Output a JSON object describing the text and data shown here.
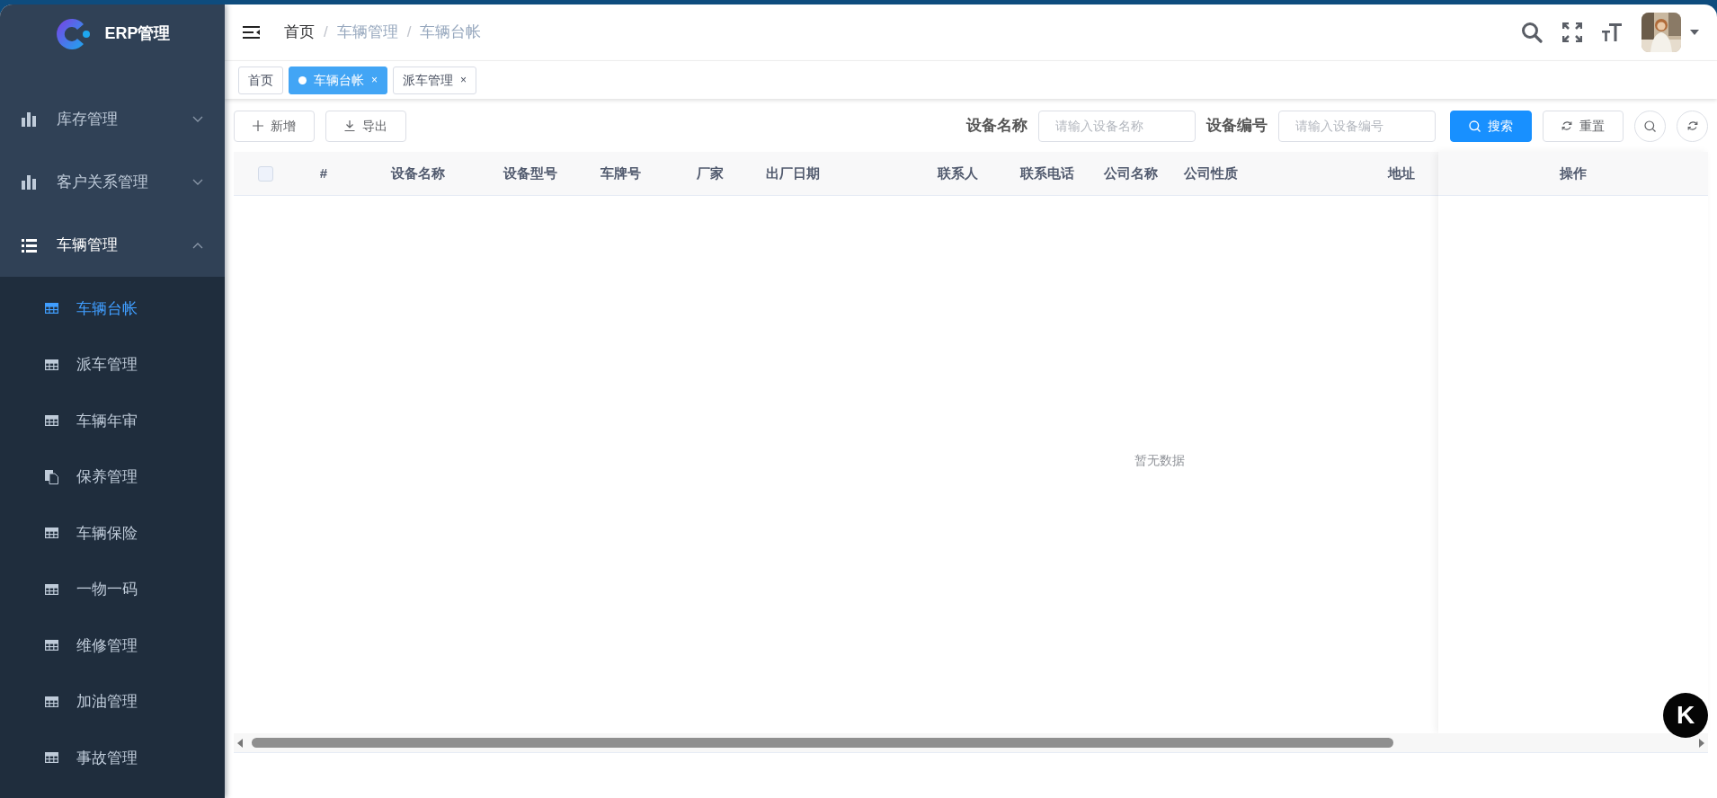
{
  "logo": {
    "title": "ERP管理"
  },
  "sidebar": {
    "items": [
      {
        "label": "库存管理",
        "expanded": false
      },
      {
        "label": "客户关系管理",
        "expanded": false
      },
      {
        "label": "车辆管理",
        "expanded": true,
        "children": [
          {
            "label": "车辆台帐",
            "kind": "grid",
            "selected": true
          },
          {
            "label": "派车管理",
            "kind": "grid",
            "selected": false
          },
          {
            "label": "车辆年审",
            "kind": "grid",
            "selected": false
          },
          {
            "label": "保养管理",
            "kind": "copy",
            "selected": false
          },
          {
            "label": "车辆保险",
            "kind": "grid",
            "selected": false
          },
          {
            "label": "一物一码",
            "kind": "grid",
            "selected": false
          },
          {
            "label": "维修管理",
            "kind": "grid",
            "selected": false
          },
          {
            "label": "加油管理",
            "kind": "grid",
            "selected": false
          },
          {
            "label": "事故管理",
            "kind": "grid",
            "selected": false
          }
        ]
      }
    ]
  },
  "breadcrumb": [
    "首页",
    "车辆管理",
    "车辆台帐"
  ],
  "breadcrumb_separator": "/",
  "tabs": [
    {
      "label": "首页",
      "selected": false
    },
    {
      "label": "车辆台帐",
      "selected": true,
      "close": "×"
    },
    {
      "label": "派车管理",
      "selected": false,
      "close": "×"
    }
  ],
  "toolbar": {
    "buttons": [
      {
        "label": "新增",
        "kind": "add"
      },
      {
        "label": "导出",
        "kind": "export"
      }
    ]
  },
  "search": {
    "fields": [
      {
        "label": "设备名称",
        "placeholder": "请输入设备名称"
      },
      {
        "label": "设备编号",
        "placeholder": "请输入设备编号"
      }
    ],
    "search_button": "搜索",
    "reset_button": "重置"
  },
  "table": {
    "select_all": {
      "checked": false
    },
    "columns": [
      "#",
      "设备名称",
      "设备型号",
      "车牌号",
      "厂家",
      "出厂日期",
      "联系人",
      "联系电话",
      "公司名称",
      "公司性质",
      "地址"
    ],
    "fixed_column": "操作",
    "empty_text": "暂无数据"
  },
  "float_button": {
    "label": "K"
  }
}
